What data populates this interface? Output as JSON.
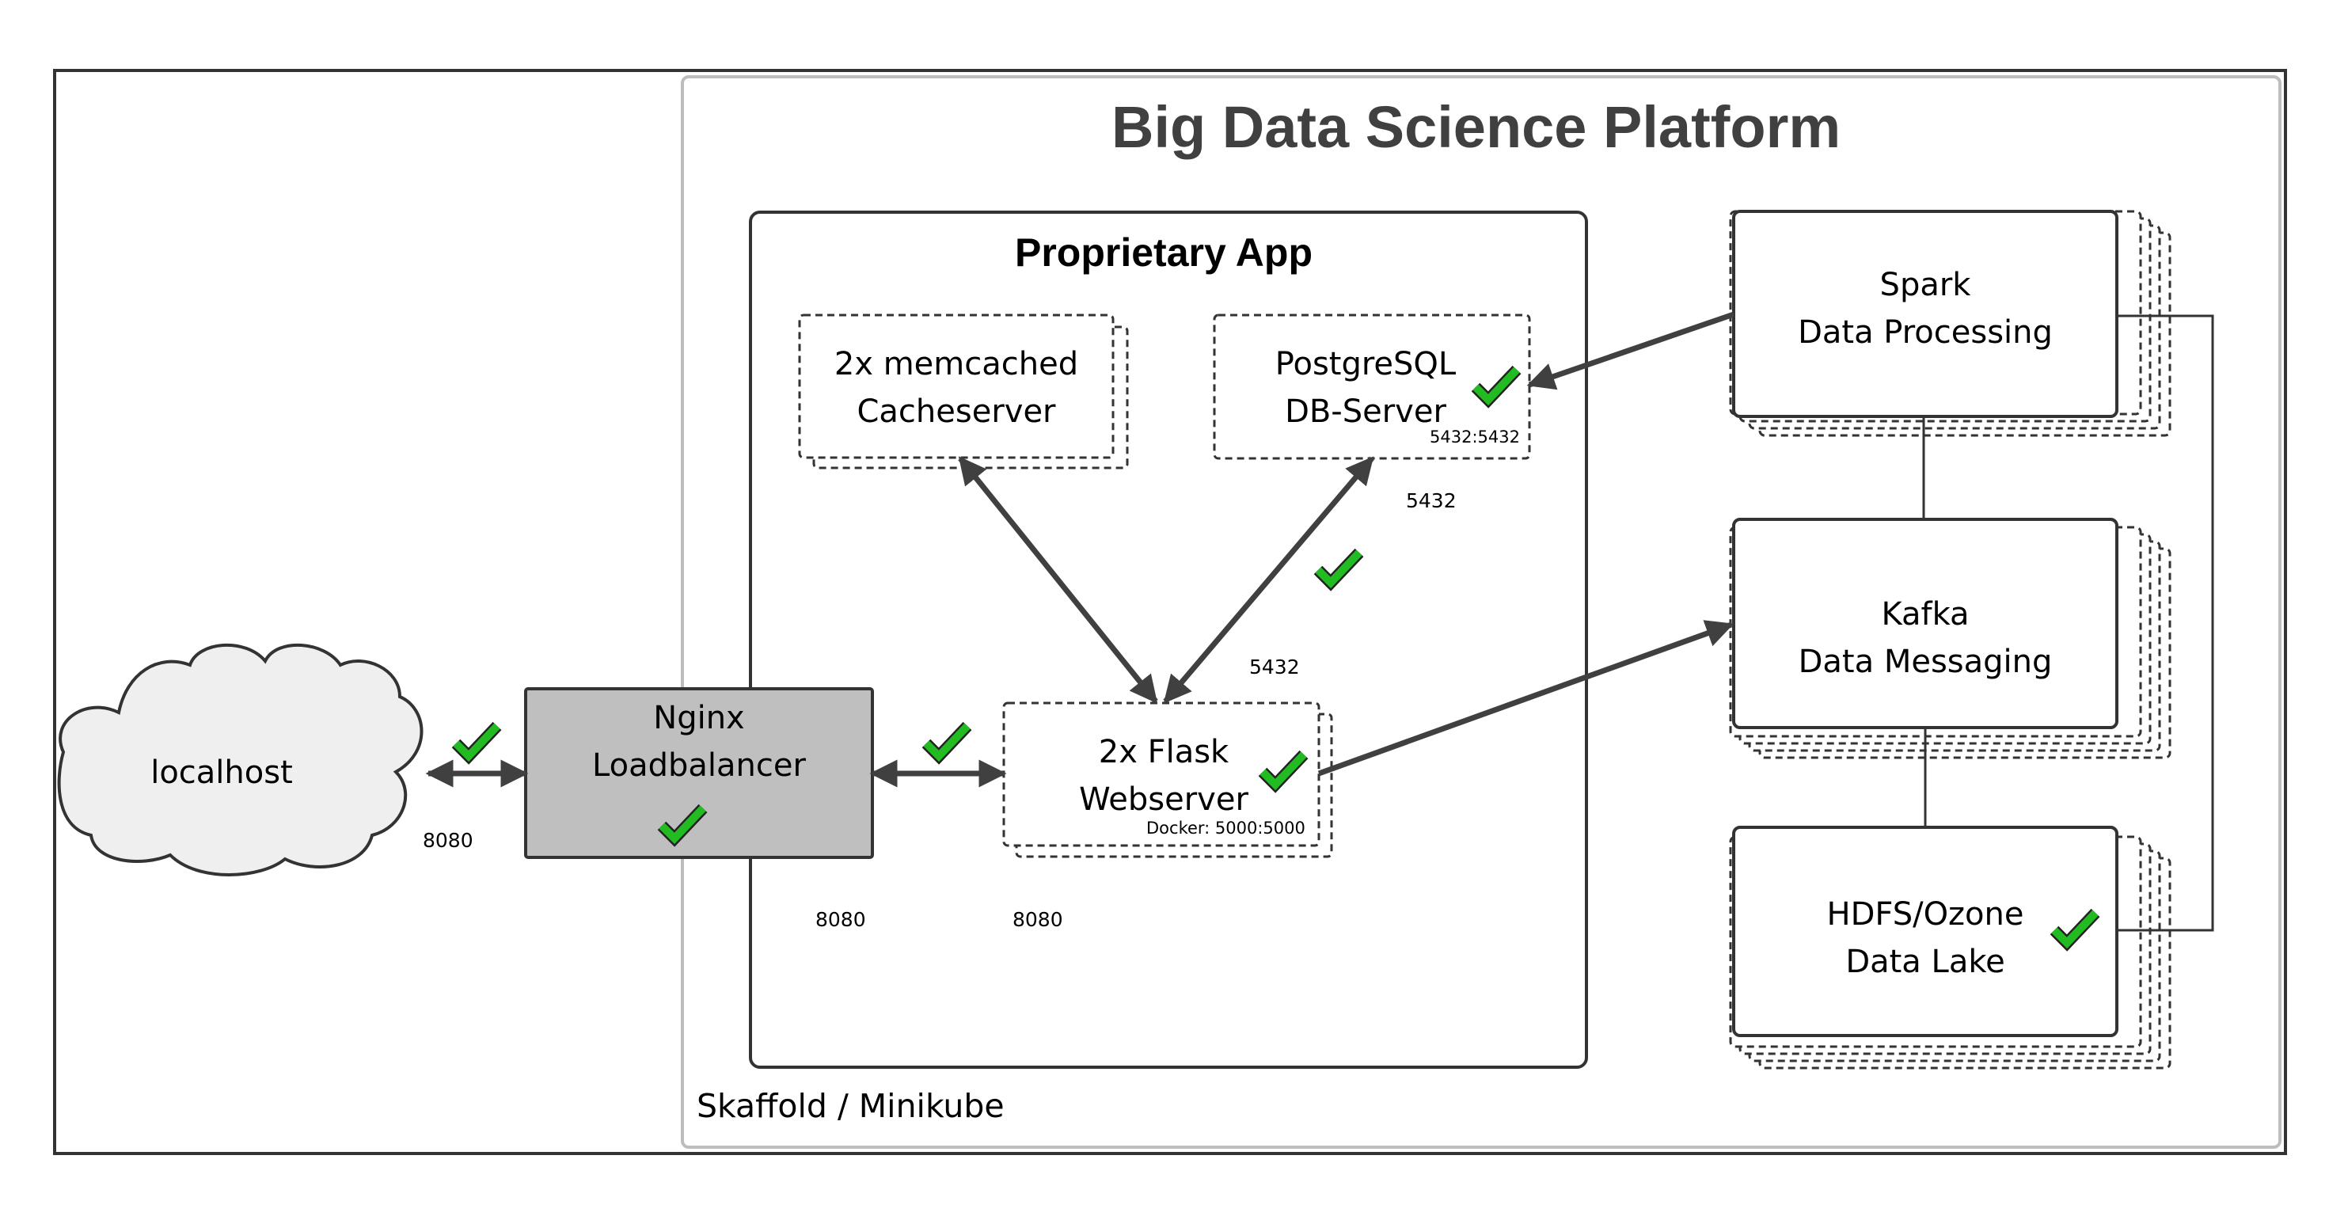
{
  "title": "Big Data Science Platform",
  "proprietary_app": {
    "title": "Proprietary App"
  },
  "environment_label": "Skaffold / Minikube",
  "nodes": {
    "localhost": {
      "label": "localhost"
    },
    "nginx": {
      "line1": "Nginx",
      "line2": "Loadbalancer"
    },
    "memcached": {
      "line1": "2x memcached",
      "line2": "Cacheserver"
    },
    "postgres": {
      "line1": "PostgreSQL",
      "line2": "DB-Server",
      "port": "5432:5432"
    },
    "flask": {
      "line1": "2x Flask",
      "line2": "Webserver",
      "port": "Docker: 5000:5000"
    },
    "spark": {
      "line1": "Spark",
      "line2": "Data Processing"
    },
    "kafka": {
      "line1": "Kafka",
      "line2": "Data Messaging"
    },
    "hdfs": {
      "line1": "HDFS/Ozone",
      "line2": "Data Lake"
    }
  },
  "ports": {
    "localhost_nginx": "8080",
    "nginx_out": "8080",
    "flask_in": "8080",
    "flask_postgres_top": "5432",
    "flask_postgres_bottom": "5432"
  },
  "colors": {
    "check": "#22bb22",
    "nginx_fill": "#bfbfbf",
    "cloud_fill": "#efefef",
    "arrow": "#404040",
    "title": "#404040"
  },
  "icons": [
    "check-icon",
    "cloud-shape"
  ]
}
